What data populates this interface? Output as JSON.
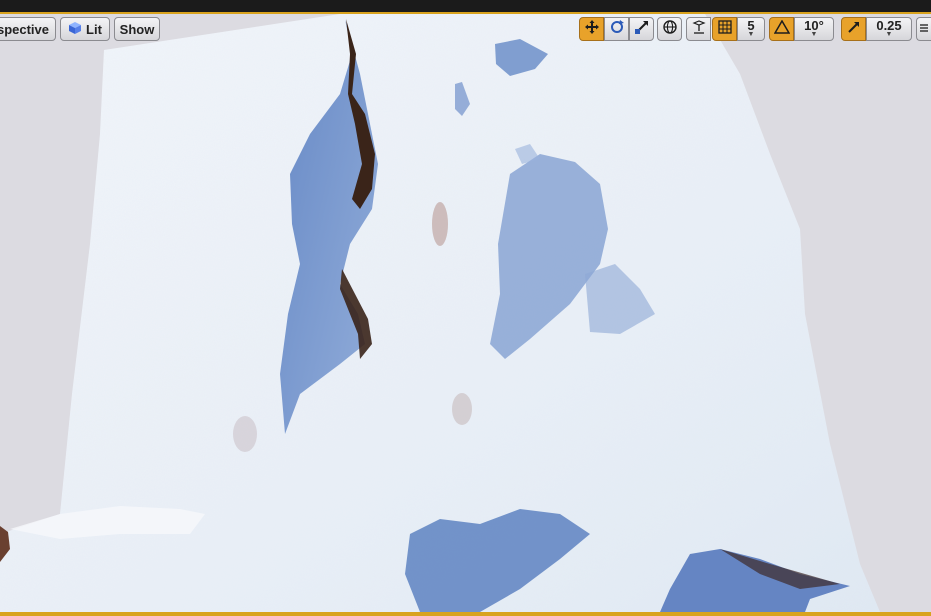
{
  "viewport": {
    "perspective_label": "Perspective",
    "lit_label": "Lit",
    "show_label": "Show"
  },
  "toolbar": {
    "grid_snap_value": "5",
    "rotation_snap_value": "10°",
    "scale_snap_value": "0.25"
  },
  "colors": {
    "accent": "#e8a22a",
    "snow": "#eef3f8",
    "ice_shadow": "#7c9bcf",
    "rock": "#3a2419"
  }
}
